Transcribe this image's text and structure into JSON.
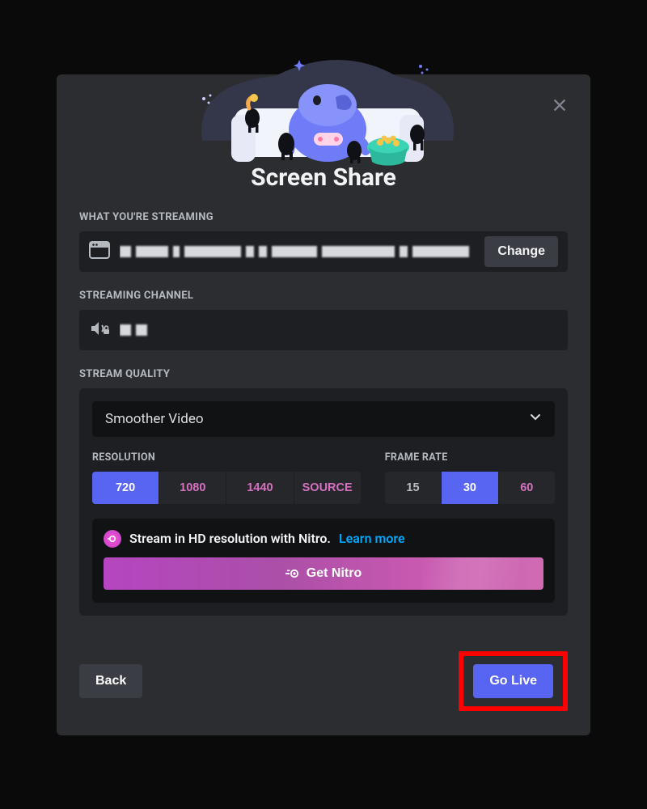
{
  "modal": {
    "title": "Screen Share",
    "close_icon": "close"
  },
  "streaming_source": {
    "label": "WHAT YOU'RE STREAMING",
    "icon": "app-window",
    "change_label": "Change"
  },
  "streaming_channel": {
    "label": "STREAMING CHANNEL",
    "icon": "speaker-locked"
  },
  "quality": {
    "label": "STREAM QUALITY",
    "preset_selected": "Smoother Video",
    "resolution": {
      "label": "RESOLUTION",
      "options": [
        {
          "label": "720",
          "active": true,
          "nitro": false
        },
        {
          "label": "1080",
          "active": false,
          "nitro": true
        },
        {
          "label": "1440",
          "active": false,
          "nitro": true
        },
        {
          "label": "SOURCE",
          "active": false,
          "nitro": true
        }
      ]
    },
    "framerate": {
      "label": "FRAME RATE",
      "options": [
        {
          "label": "15",
          "active": false,
          "nitro": false
        },
        {
          "label": "30",
          "active": true,
          "nitro": false
        },
        {
          "label": "60",
          "active": false,
          "nitro": true
        }
      ]
    },
    "upsell": {
      "text": "Stream in HD resolution with Nitro.",
      "link": "Learn more",
      "button": "Get Nitro"
    }
  },
  "footer": {
    "back": "Back",
    "go_live": "Go Live"
  },
  "colors": {
    "accent": "#5865f2",
    "nitro_pink": "#d670c0",
    "link_blue": "#00a8fc"
  }
}
